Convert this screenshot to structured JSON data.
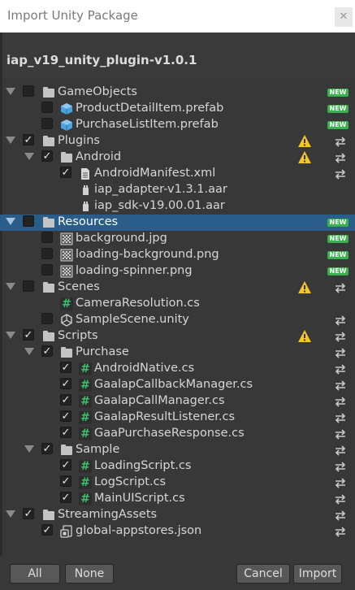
{
  "window": {
    "title": "Import Unity Package",
    "close_icon": "close-icon"
  },
  "package": {
    "name": "iap_v19_unity_plugin-v1.0.1"
  },
  "badges": {
    "new": "NEW"
  },
  "colors": {
    "background": "#383838",
    "selected_row": "#2b5d8a",
    "new_badge": "#37b24d",
    "cs_icon": "#39c16b",
    "warning": "#f3c42f"
  },
  "tree": [
    {
      "label": "GameObjects",
      "icon": "folder-icon",
      "checked": false,
      "badge": "new"
    },
    {
      "label": "ProductDetailItem.prefab",
      "icon": "prefab-icon",
      "checked": false,
      "badge": "new"
    },
    {
      "label": "PurchaseListItem.prefab",
      "icon": "prefab-icon",
      "checked": false,
      "badge": "new"
    },
    {
      "label": "Plugins",
      "icon": "folder-icon",
      "checked": true,
      "warning": true,
      "badge": "changed"
    },
    {
      "label": "Android",
      "icon": "folder-icon",
      "checked": true,
      "warning": true,
      "badge": "changed"
    },
    {
      "label": "AndroidManifest.xml",
      "icon": "document-icon",
      "checked": true,
      "badge": "changed"
    },
    {
      "label": "iap_adapter-v1.3.1.aar",
      "icon": "plugin-icon",
      "checked": null
    },
    {
      "label": "iap_sdk-v19.00.01.aar",
      "icon": "plugin-icon",
      "checked": null
    },
    {
      "label": "Resources",
      "icon": "folder-icon",
      "checked": false,
      "badge": "new",
      "selected": true
    },
    {
      "label": "background.jpg",
      "icon": "image-icon",
      "checked": false,
      "badge": "new"
    },
    {
      "label": "loading-background.png",
      "icon": "image-icon",
      "checked": false,
      "badge": "new"
    },
    {
      "label": "loading-spinner.png",
      "icon": "image-icon",
      "checked": false,
      "badge": "new"
    },
    {
      "label": "Scenes",
      "icon": "folder-icon",
      "checked": false,
      "warning": true,
      "badge": "changed"
    },
    {
      "label": "CameraResolution.cs",
      "icon": "cs-script-icon",
      "checked": null
    },
    {
      "label": "SampleScene.unity",
      "icon": "unity-scene-icon",
      "checked": false,
      "badge": "changed"
    },
    {
      "label": "Scripts",
      "icon": "folder-icon",
      "checked": true,
      "warning": true,
      "badge": "changed"
    },
    {
      "label": "Purchase",
      "icon": "folder-icon",
      "checked": true,
      "badge": "changed"
    },
    {
      "label": "AndroidNative.cs",
      "icon": "cs-script-icon",
      "checked": true,
      "badge": "changed"
    },
    {
      "label": "GaalapCallbackManager.cs",
      "icon": "cs-script-icon",
      "checked": true,
      "badge": "changed"
    },
    {
      "label": "GaalapCallManager.cs",
      "icon": "cs-script-icon",
      "checked": true,
      "badge": "changed"
    },
    {
      "label": "GaalapResultListener.cs",
      "icon": "cs-script-icon",
      "checked": true,
      "badge": "changed"
    },
    {
      "label": "GaaPurchaseResponse.cs",
      "icon": "cs-script-icon",
      "checked": true,
      "badge": "changed"
    },
    {
      "label": "Sample",
      "icon": "folder-icon",
      "checked": true,
      "badge": "changed"
    },
    {
      "label": "LoadingScript.cs",
      "icon": "cs-script-icon",
      "checked": true,
      "badge": "changed"
    },
    {
      "label": "LogScript.cs",
      "icon": "cs-script-icon",
      "checked": true,
      "badge": "changed"
    },
    {
      "label": "MainUIScript.cs",
      "icon": "cs-script-icon",
      "checked": true,
      "badge": "changed"
    },
    {
      "label": "StreamingAssets",
      "icon": "folder-icon",
      "checked": true,
      "badge": "changed"
    },
    {
      "label": "global-appstores.json",
      "icon": "json-file-icon",
      "checked": true,
      "badge": "changed"
    }
  ],
  "buttons": {
    "all": "All",
    "none": "None",
    "cancel": "Cancel",
    "import": "Import"
  }
}
